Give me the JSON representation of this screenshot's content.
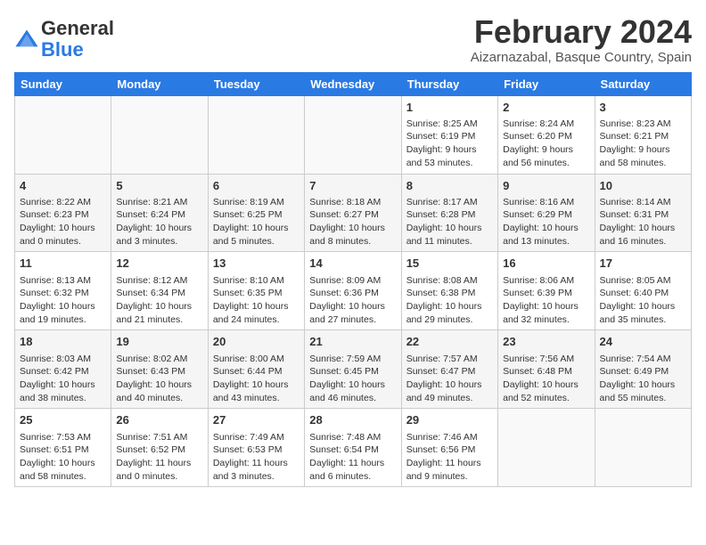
{
  "header": {
    "logo_general": "General",
    "logo_blue": "Blue",
    "month_title": "February 2024",
    "subtitle": "Aizarnazabal, Basque Country, Spain"
  },
  "weekdays": [
    "Sunday",
    "Monday",
    "Tuesday",
    "Wednesday",
    "Thursday",
    "Friday",
    "Saturday"
  ],
  "weeks": [
    [
      {
        "day": "",
        "info": ""
      },
      {
        "day": "",
        "info": ""
      },
      {
        "day": "",
        "info": ""
      },
      {
        "day": "",
        "info": ""
      },
      {
        "day": "1",
        "info": "Sunrise: 8:25 AM\nSunset: 6:19 PM\nDaylight: 9 hours\nand 53 minutes."
      },
      {
        "day": "2",
        "info": "Sunrise: 8:24 AM\nSunset: 6:20 PM\nDaylight: 9 hours\nand 56 minutes."
      },
      {
        "day": "3",
        "info": "Sunrise: 8:23 AM\nSunset: 6:21 PM\nDaylight: 9 hours\nand 58 minutes."
      }
    ],
    [
      {
        "day": "4",
        "info": "Sunrise: 8:22 AM\nSunset: 6:23 PM\nDaylight: 10 hours\nand 0 minutes."
      },
      {
        "day": "5",
        "info": "Sunrise: 8:21 AM\nSunset: 6:24 PM\nDaylight: 10 hours\nand 3 minutes."
      },
      {
        "day": "6",
        "info": "Sunrise: 8:19 AM\nSunset: 6:25 PM\nDaylight: 10 hours\nand 5 minutes."
      },
      {
        "day": "7",
        "info": "Sunrise: 8:18 AM\nSunset: 6:27 PM\nDaylight: 10 hours\nand 8 minutes."
      },
      {
        "day": "8",
        "info": "Sunrise: 8:17 AM\nSunset: 6:28 PM\nDaylight: 10 hours\nand 11 minutes."
      },
      {
        "day": "9",
        "info": "Sunrise: 8:16 AM\nSunset: 6:29 PM\nDaylight: 10 hours\nand 13 minutes."
      },
      {
        "day": "10",
        "info": "Sunrise: 8:14 AM\nSunset: 6:31 PM\nDaylight: 10 hours\nand 16 minutes."
      }
    ],
    [
      {
        "day": "11",
        "info": "Sunrise: 8:13 AM\nSunset: 6:32 PM\nDaylight: 10 hours\nand 19 minutes."
      },
      {
        "day": "12",
        "info": "Sunrise: 8:12 AM\nSunset: 6:34 PM\nDaylight: 10 hours\nand 21 minutes."
      },
      {
        "day": "13",
        "info": "Sunrise: 8:10 AM\nSunset: 6:35 PM\nDaylight: 10 hours\nand 24 minutes."
      },
      {
        "day": "14",
        "info": "Sunrise: 8:09 AM\nSunset: 6:36 PM\nDaylight: 10 hours\nand 27 minutes."
      },
      {
        "day": "15",
        "info": "Sunrise: 8:08 AM\nSunset: 6:38 PM\nDaylight: 10 hours\nand 29 minutes."
      },
      {
        "day": "16",
        "info": "Sunrise: 8:06 AM\nSunset: 6:39 PM\nDaylight: 10 hours\nand 32 minutes."
      },
      {
        "day": "17",
        "info": "Sunrise: 8:05 AM\nSunset: 6:40 PM\nDaylight: 10 hours\nand 35 minutes."
      }
    ],
    [
      {
        "day": "18",
        "info": "Sunrise: 8:03 AM\nSunset: 6:42 PM\nDaylight: 10 hours\nand 38 minutes."
      },
      {
        "day": "19",
        "info": "Sunrise: 8:02 AM\nSunset: 6:43 PM\nDaylight: 10 hours\nand 40 minutes."
      },
      {
        "day": "20",
        "info": "Sunrise: 8:00 AM\nSunset: 6:44 PM\nDaylight: 10 hours\nand 43 minutes."
      },
      {
        "day": "21",
        "info": "Sunrise: 7:59 AM\nSunset: 6:45 PM\nDaylight: 10 hours\nand 46 minutes."
      },
      {
        "day": "22",
        "info": "Sunrise: 7:57 AM\nSunset: 6:47 PM\nDaylight: 10 hours\nand 49 minutes."
      },
      {
        "day": "23",
        "info": "Sunrise: 7:56 AM\nSunset: 6:48 PM\nDaylight: 10 hours\nand 52 minutes."
      },
      {
        "day": "24",
        "info": "Sunrise: 7:54 AM\nSunset: 6:49 PM\nDaylight: 10 hours\nand 55 minutes."
      }
    ],
    [
      {
        "day": "25",
        "info": "Sunrise: 7:53 AM\nSunset: 6:51 PM\nDaylight: 10 hours\nand 58 minutes."
      },
      {
        "day": "26",
        "info": "Sunrise: 7:51 AM\nSunset: 6:52 PM\nDaylight: 11 hours\nand 0 minutes."
      },
      {
        "day": "27",
        "info": "Sunrise: 7:49 AM\nSunset: 6:53 PM\nDaylight: 11 hours\nand 3 minutes."
      },
      {
        "day": "28",
        "info": "Sunrise: 7:48 AM\nSunset: 6:54 PM\nDaylight: 11 hours\nand 6 minutes."
      },
      {
        "day": "29",
        "info": "Sunrise: 7:46 AM\nSunset: 6:56 PM\nDaylight: 11 hours\nand 9 minutes."
      },
      {
        "day": "",
        "info": ""
      },
      {
        "day": "",
        "info": ""
      }
    ]
  ]
}
